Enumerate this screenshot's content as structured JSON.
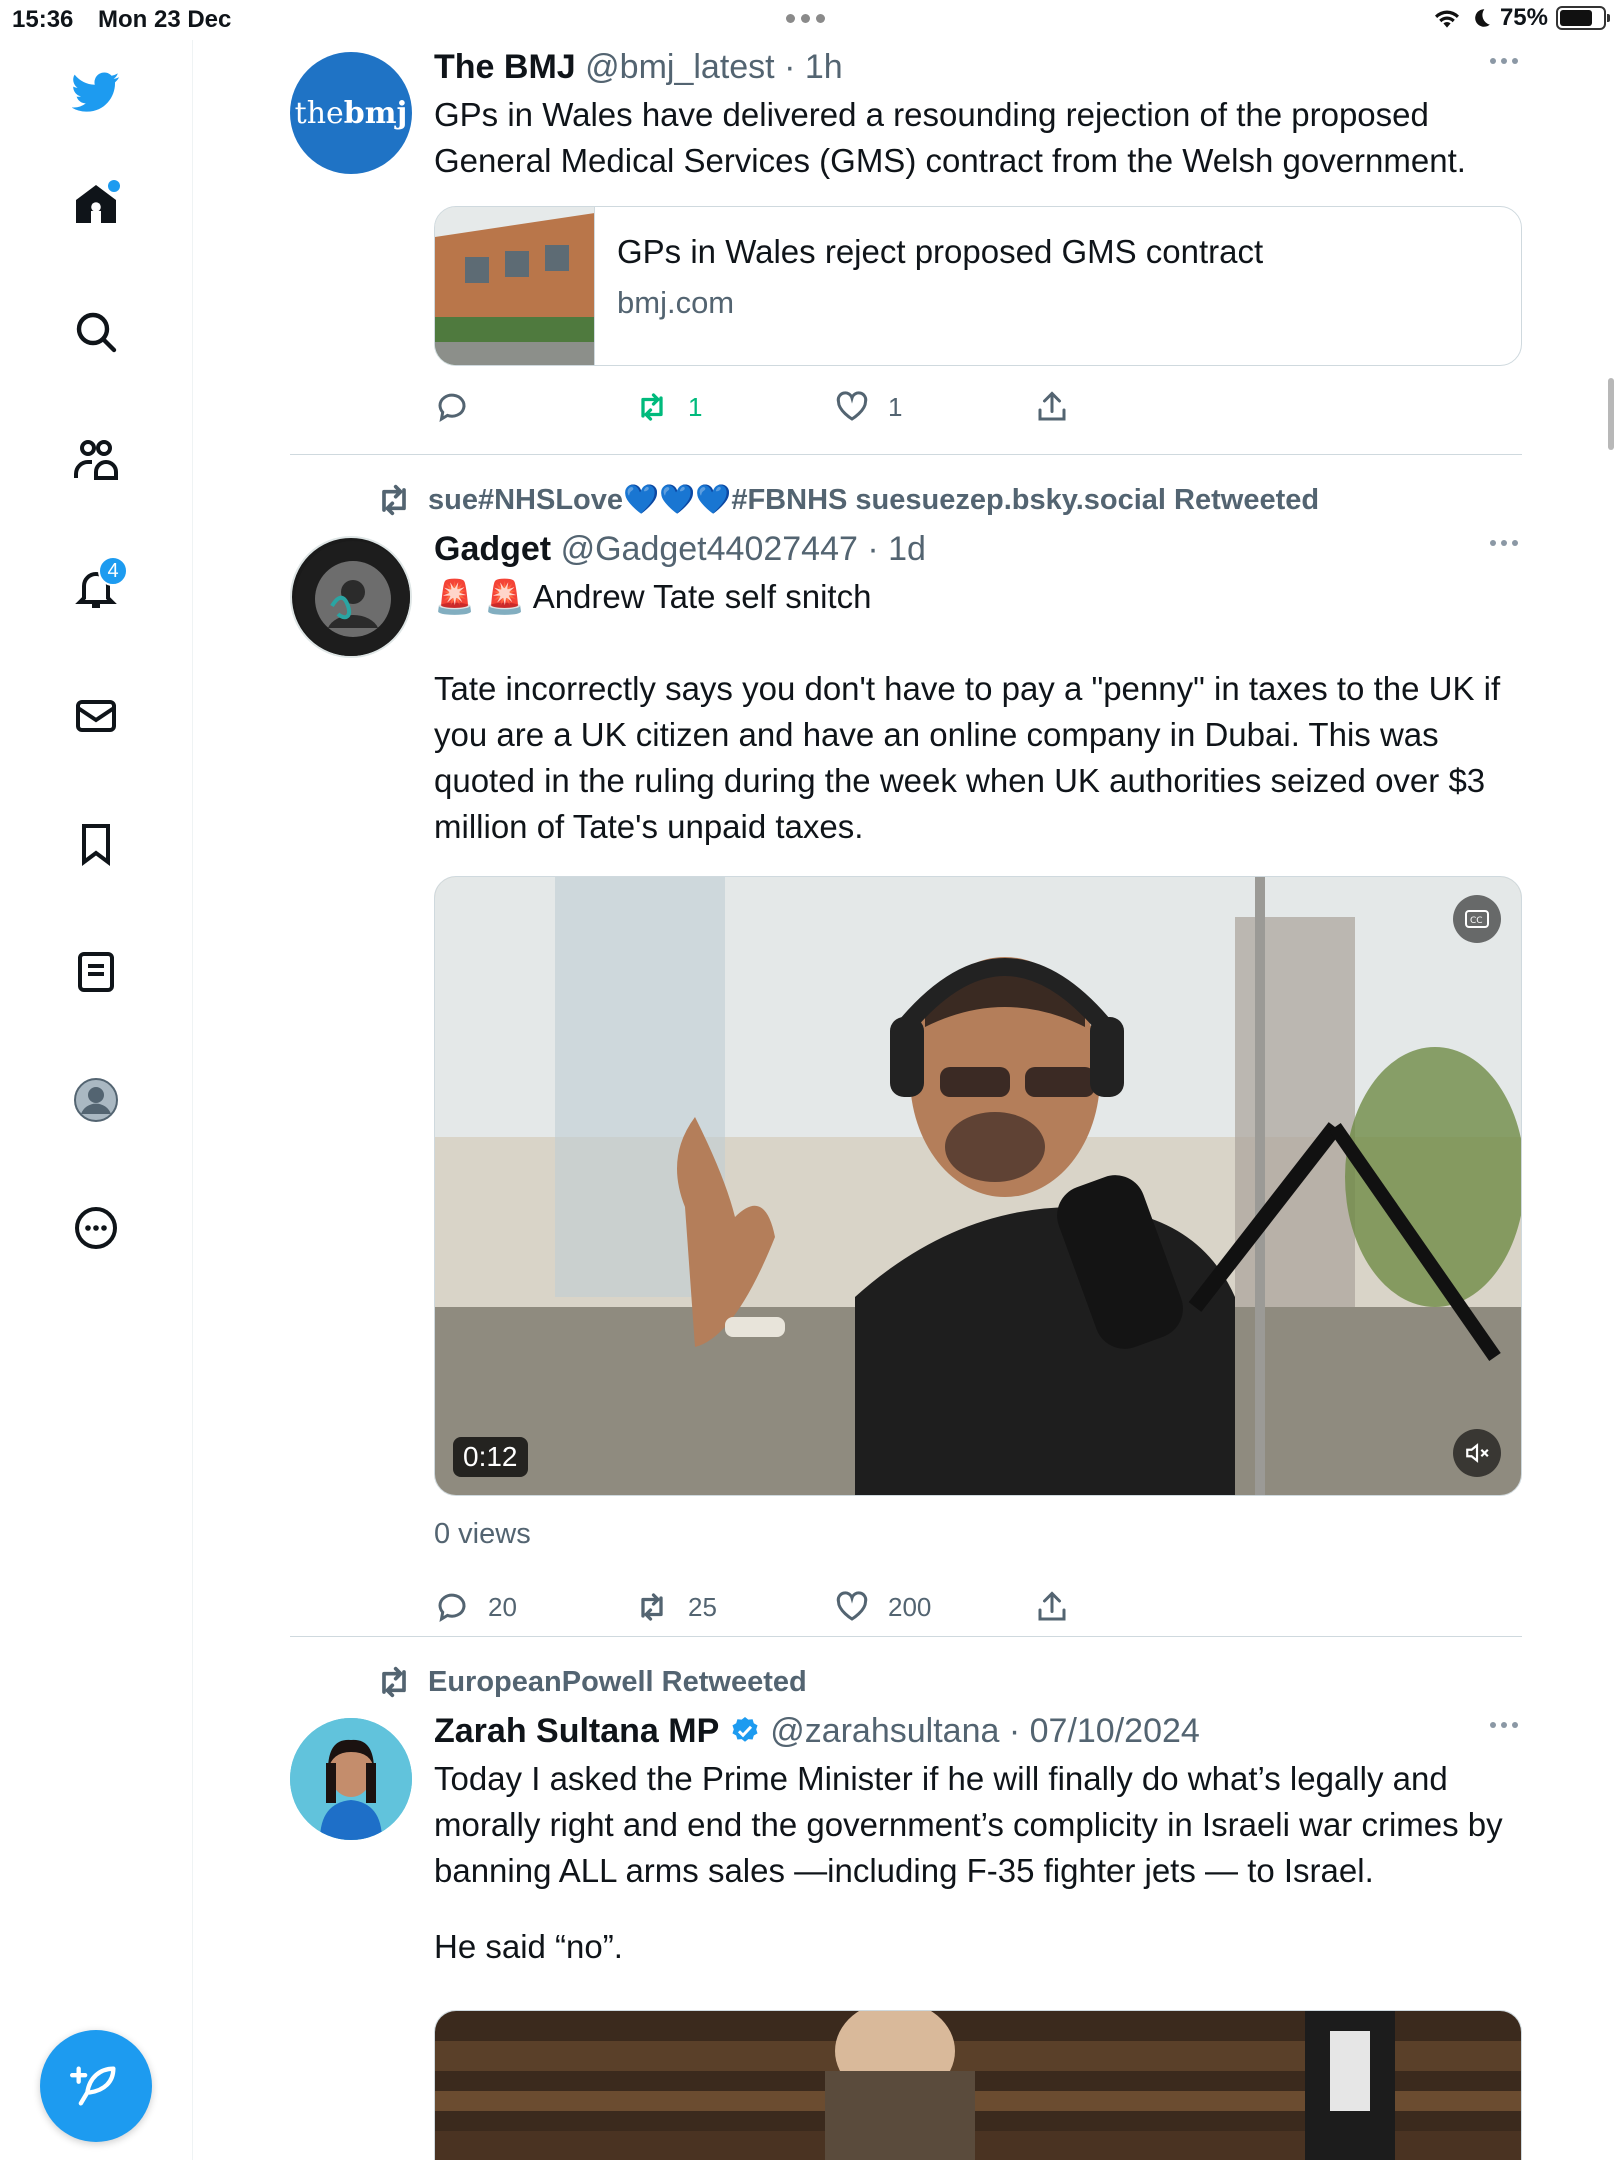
{
  "status_bar": {
    "time": "15:36",
    "date": "Mon 23 Dec",
    "battery": "75%",
    "battery_level": 0.75
  },
  "sidebar": {
    "items": [
      {
        "name": "twitter-logo"
      },
      {
        "name": "home"
      },
      {
        "name": "explore"
      },
      {
        "name": "communities"
      },
      {
        "name": "notifications",
        "badge": "4"
      },
      {
        "name": "messages"
      },
      {
        "name": "bookmarks"
      },
      {
        "name": "lists"
      },
      {
        "name": "profile"
      },
      {
        "name": "more"
      }
    ],
    "accent_color": "#1d9bf0"
  },
  "tweets": [
    {
      "name": "The BMJ",
      "handle": "@bmj_latest",
      "sep": "·",
      "time": "1h",
      "avatar_text_a": "the",
      "avatar_text_b": "bmj",
      "text": "GPs in Wales have delivered a resounding rejection of the proposed General Medical Services (GMS) contract from the Welsh government.",
      "link_card": {
        "title": "GPs in Wales reject proposed GMS contract",
        "domain": "bmj.com"
      },
      "actions": {
        "reply": "",
        "retweet": "1",
        "like": "1"
      }
    },
    {
      "retweeted_by": "sue#NHSLove💙💙💙#FBNHS suesuezep.bsky.social Retweeted",
      "name": "Gadget",
      "handle": "@Gadget44027447",
      "sep": "·",
      "time": "1d",
      "text_line1": "🚨 🚨 Andrew Tate self snitch",
      "text_para": "Tate incorrectly says you don't have to pay a \"penny\" in taxes to the UK if you are a UK citizen and have an online company in Dubai. This was quoted in the ruling during the week when UK authorities seized over $3 million of Tate's unpaid taxes.",
      "video": {
        "duration": "0:12"
      },
      "views": "0 views",
      "actions": {
        "reply": "20",
        "retweet": "25",
        "like": "200"
      }
    },
    {
      "retweeted_by": "EuropeanPowell Retweeted",
      "name": "Zarah Sultana MP",
      "handle": "@zarahsultana",
      "sep": "·",
      "time": "07/10/2024",
      "text_para1": "Today I asked the Prime Minister if he will finally do what’s legally and morally right and end the government’s complicity in Israeli war crimes by banning ALL arms sales —including F-35 fighter jets — to Israel.",
      "text_para2": "He said “no”."
    }
  ]
}
